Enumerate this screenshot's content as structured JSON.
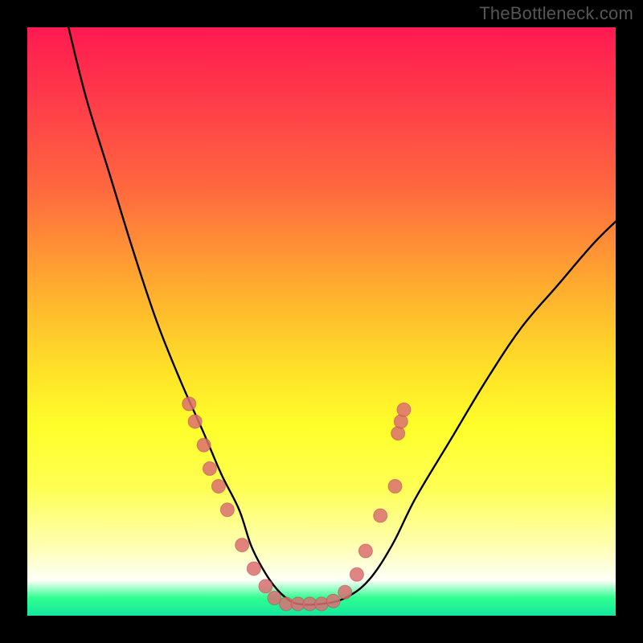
{
  "watermark_text": "TheBottleneck.com",
  "colors": {
    "frame": "#000000",
    "curve": "#000000",
    "dot_fill": "#db6e72",
    "dot_stroke": "#b94a52",
    "watermark": "#565656"
  },
  "chart_data": {
    "type": "line",
    "title": "",
    "xlabel": "",
    "ylabel": "",
    "xlim": [
      0,
      100
    ],
    "ylim": [
      0,
      100
    ],
    "note": "Axis units unlabeled; values are estimated fractions of plot width/height (0–100). Y=0 at bottom (green), Y=100 at top (red).",
    "series": [
      {
        "name": "bottleneck-curve",
        "x": [
          7,
          10,
          14,
          18,
          22,
          26,
          30,
          33,
          36,
          38,
          40,
          42,
          44,
          46,
          50,
          54,
          58,
          62,
          66,
          72,
          78,
          84,
          90,
          96,
          100
        ],
        "y": [
          100,
          88,
          75,
          62,
          50,
          40,
          31,
          24,
          18,
          12,
          8,
          5,
          3,
          2,
          2,
          3,
          6,
          12,
          20,
          30,
          40,
          49,
          56,
          63,
          67
        ]
      }
    ],
    "dots": [
      {
        "x": 27.5,
        "y": 36
      },
      {
        "x": 28.5,
        "y": 33
      },
      {
        "x": 30.0,
        "y": 29
      },
      {
        "x": 31.0,
        "y": 25
      },
      {
        "x": 32.5,
        "y": 22
      },
      {
        "x": 34.0,
        "y": 18
      },
      {
        "x": 36.5,
        "y": 12
      },
      {
        "x": 38.5,
        "y": 8
      },
      {
        "x": 40.5,
        "y": 5
      },
      {
        "x": 42.0,
        "y": 3
      },
      {
        "x": 44.0,
        "y": 2
      },
      {
        "x": 46.0,
        "y": 2
      },
      {
        "x": 48.0,
        "y": 2
      },
      {
        "x": 50.0,
        "y": 2
      },
      {
        "x": 52.0,
        "y": 2.5
      },
      {
        "x": 54.0,
        "y": 4
      },
      {
        "x": 56.0,
        "y": 7
      },
      {
        "x": 57.5,
        "y": 11
      },
      {
        "x": 60.0,
        "y": 17
      },
      {
        "x": 62.5,
        "y": 22
      },
      {
        "x": 63.0,
        "y": 31
      },
      {
        "x": 63.5,
        "y": 33
      },
      {
        "x": 64.0,
        "y": 35
      }
    ]
  }
}
